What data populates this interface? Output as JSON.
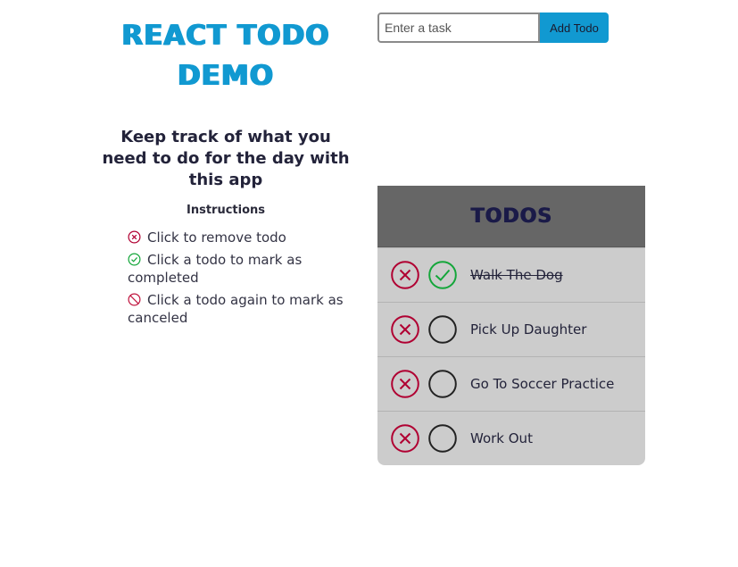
{
  "header": {
    "title": "REACT TODO DEMO",
    "tagline": "Keep track of what you need to do for the day with this app"
  },
  "instructions": {
    "heading": "Instructions",
    "items": [
      {
        "icon": "remove-circle-icon",
        "text": "Click to remove todo"
      },
      {
        "icon": "check-circle-icon",
        "text": "Click a todo to mark as completed"
      },
      {
        "icon": "cancel-circle-icon",
        "text": "Click a todo again to mark as canceled"
      }
    ]
  },
  "form": {
    "placeholder": "Enter a task",
    "value": "",
    "button_label": "Add Todo"
  },
  "todos": {
    "heading": "TODOS",
    "items": [
      {
        "text": "Walk The Dog",
        "status": "completed"
      },
      {
        "text": "Pick Up Daughter",
        "status": "pending"
      },
      {
        "text": "Go To Soccer Practice",
        "status": "pending"
      },
      {
        "text": "Work Out",
        "status": "pending"
      }
    ]
  },
  "colors": {
    "accent": "#1199d1",
    "remove": "#b00032",
    "complete": "#14a63a",
    "cancel": "#c0163f",
    "header_bg": "#666666",
    "row_bg": "#cccccc"
  }
}
